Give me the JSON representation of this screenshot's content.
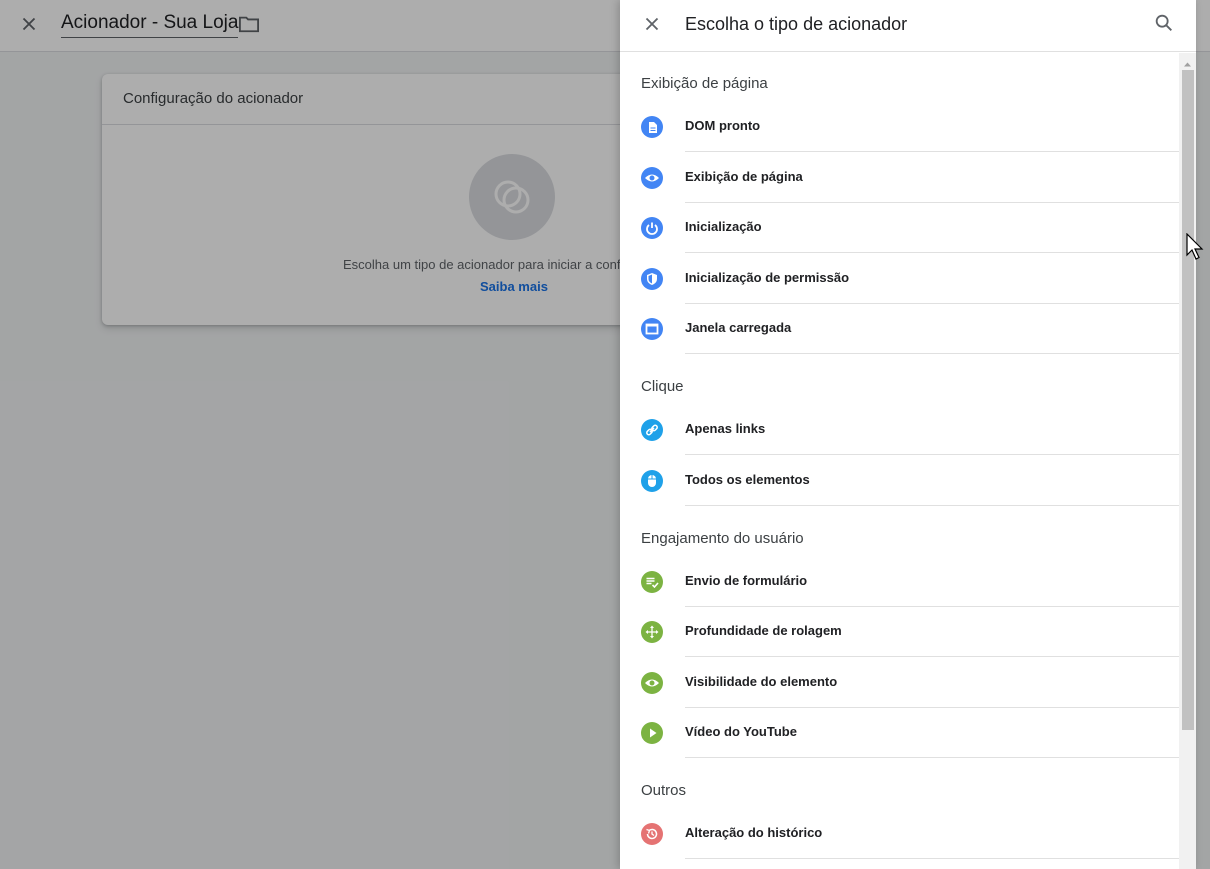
{
  "background": {
    "header": {
      "title": "Acionador - Sua Loja",
      "close_icon": "close-icon",
      "folder_icon": "folder-icon"
    },
    "card": {
      "title": "Configuração do acionador",
      "description": "Escolha um tipo de acionador para iniciar a conf",
      "link": "Saiba mais"
    }
  },
  "panel": {
    "title": "Escolha o tipo de acionador",
    "close_icon": "close-icon",
    "search_icon": "search-icon",
    "sections": [
      {
        "title": "Exibição de página",
        "color": "#4285f4",
        "items": [
          {
            "label": "DOM pronto",
            "icon": "document-icon"
          },
          {
            "label": "Exibição de página",
            "icon": "eye-icon"
          },
          {
            "label": "Inicialização",
            "icon": "power-icon"
          },
          {
            "label": "Inicialização de permissão",
            "icon": "shield-icon"
          },
          {
            "label": "Janela carregada",
            "icon": "window-icon"
          }
        ]
      },
      {
        "title": "Clique",
        "color": "#1fa1e9",
        "items": [
          {
            "label": "Apenas links",
            "icon": "link-icon"
          },
          {
            "label": "Todos os elementos",
            "icon": "mouse-icon"
          }
        ]
      },
      {
        "title": "Engajamento do usuário",
        "color": "#7cb342",
        "items": [
          {
            "label": "Envio de formulário",
            "icon": "form-icon"
          },
          {
            "label": "Profundidade de rolagem",
            "icon": "move-icon"
          },
          {
            "label": "Visibilidade do elemento",
            "icon": "eye-icon"
          },
          {
            "label": "Vídeo do YouTube",
            "icon": "play-icon"
          }
        ]
      },
      {
        "title": "Outros",
        "color": "#e57373",
        "items": [
          {
            "label": "Alteração do histórico",
            "icon": "history-icon"
          }
        ]
      }
    ]
  },
  "colors": {
    "accent": "#1a73e8",
    "scrim": "rgba(0,0,0,0.32)"
  }
}
